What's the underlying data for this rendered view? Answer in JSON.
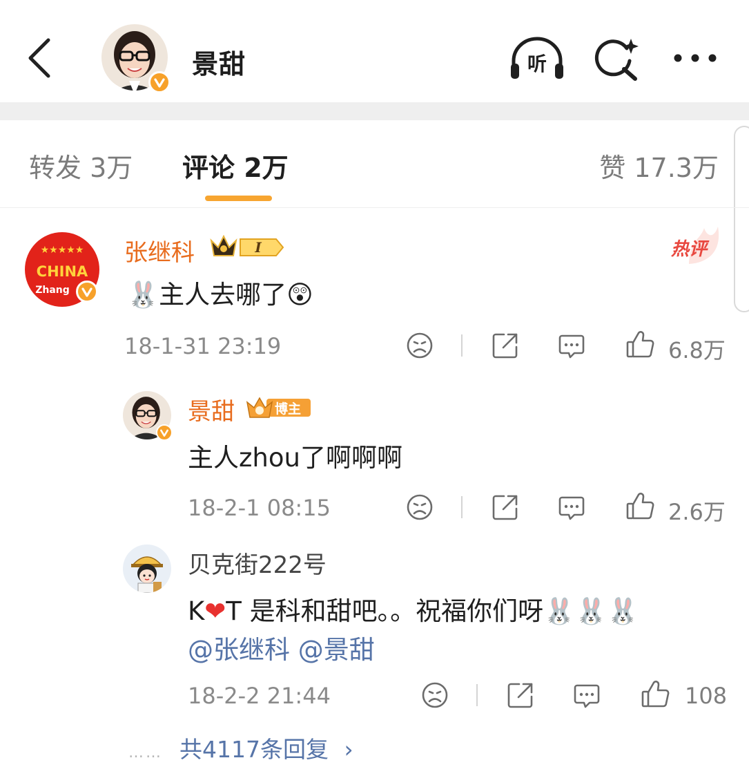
{
  "header": {
    "title": "景甜",
    "listen_label": "听"
  },
  "tabs": {
    "repost": "转发 3万",
    "comments": "评论 2万",
    "likes": "赞 17.3万"
  },
  "colors": {
    "accent": "#f7a530",
    "username_orange": "#e86c1e",
    "mention_blue": "#5674a8",
    "hot_red": "#e8483f",
    "verify_orange": "#f7a12a"
  },
  "comments": [
    {
      "username": "张继科",
      "badge_icon": "crown-fan-level-badge",
      "badge_level": "I",
      "avatar_text_top": "CHINA",
      "avatar_text_bottom": "Zhang",
      "avatar_stars": "★★★★★",
      "hot_label": "热评",
      "emoji_prefix": "🐰",
      "text": "主人去哪了",
      "emoji_suffix": "😲",
      "time": "18-1-31 23:19",
      "likes": "6.8万"
    },
    {
      "username": "景甜",
      "badge_icon": "blogger-badge",
      "badge_label": "博主",
      "text": "主人zhou了啊啊啊",
      "time": "18-2-1 08:15",
      "likes": "2.6万"
    },
    {
      "username": "贝克街222号",
      "text_k": "K",
      "text_heart": "❤",
      "text_rest": "T 是科和甜吧。。祝福你们呀",
      "emoji_suffix": "🐰🐰🐰",
      "mention_1": "@张继科",
      "mention_2": "@景甜",
      "time": "18-2-2 21:44",
      "likes": "108"
    }
  ],
  "more_replies": {
    "dots": "……",
    "label": "共4117条回复",
    "chevron": "›"
  }
}
